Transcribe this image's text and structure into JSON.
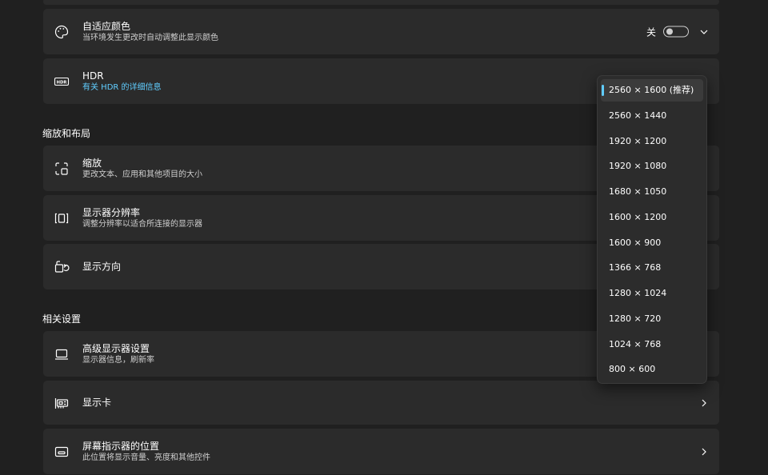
{
  "cards": {
    "adaptive_color": {
      "title": "自适应颜色",
      "subtitle": "当环境发生更改时自动调整此显示颜色",
      "toggle_state": "关",
      "icon": "palette-icon"
    },
    "hdr": {
      "title": "HDR",
      "subtitle": "有关 HDR 的详细信息",
      "icon": "hdr-icon"
    },
    "scale": {
      "title": "缩放",
      "subtitle": "更改文本、应用和其他项目的大小",
      "icon": "scale-icon"
    },
    "resolution": {
      "title": "显示器分辨率",
      "subtitle": "调整分辨率以适合所连接的显示器",
      "icon": "resolution-icon"
    },
    "orientation": {
      "title": "显示方向",
      "icon": "orientation-icon"
    },
    "advanced_display": {
      "title": "高级显示器设置",
      "subtitle": "显示器信息，刷新率",
      "icon": "monitor-icon"
    },
    "graphics": {
      "title": "显示卡",
      "icon": "graphics-card-icon"
    },
    "screen_indicator": {
      "title": "屏幕指示器的位置",
      "subtitle": "此位置将显示音量、亮度和其他控件",
      "icon": "indicator-icon"
    }
  },
  "sections": {
    "scale_layout": "缩放和布局",
    "related": "相关设置"
  },
  "resolution_dropdown": {
    "selected_index": 0,
    "options": [
      "2560 × 1600 (推荐)",
      "2560 × 1440",
      "1920 × 1200",
      "1920 × 1080",
      "1680 × 1050",
      "1600 × 1200",
      "1600 × 900",
      "1366 × 768",
      "1280 × 1024",
      "1280 × 720",
      "1024 × 768",
      "800 × 600"
    ]
  },
  "colors": {
    "accent": "#60cdff",
    "card": "#2b2b2b",
    "background": "#202020"
  }
}
